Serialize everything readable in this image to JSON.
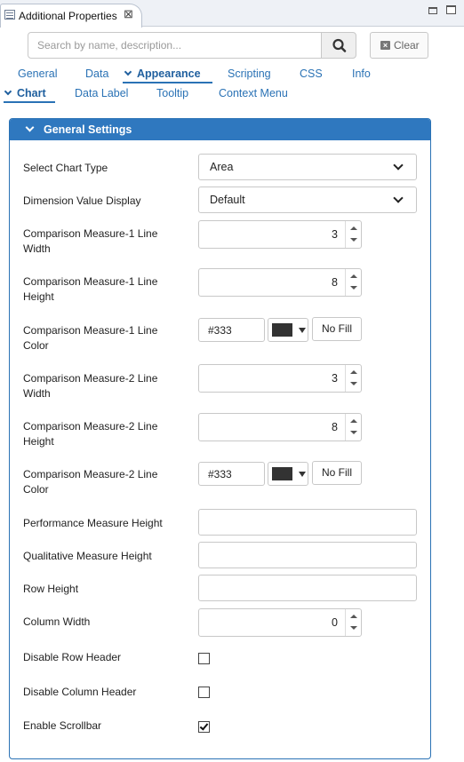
{
  "view": {
    "title": "Additional Properties",
    "close_glyph": "⊠"
  },
  "search": {
    "placeholder": "Search by name, description...",
    "value": "",
    "clear_label": "Clear"
  },
  "tabs": [
    {
      "label": "General"
    },
    {
      "label": "Data"
    },
    {
      "label": "Appearance",
      "active": true
    },
    {
      "label": "Scripting"
    },
    {
      "label": "CSS"
    },
    {
      "label": "Info"
    }
  ],
  "subtabs": [
    {
      "label": "Chart",
      "active": true
    },
    {
      "label": "Data Label"
    },
    {
      "label": "Tooltip"
    },
    {
      "label": "Context Menu"
    }
  ],
  "section": {
    "title": "General Settings"
  },
  "fields": {
    "chart_type": {
      "label": "Select Chart Type",
      "value": "Area"
    },
    "dimension_display": {
      "label": "Dimension Value Display",
      "value": "Default"
    },
    "cm1_line_width": {
      "label": "Comparison Measure-1 Line Width",
      "value": "3"
    },
    "cm1_line_height": {
      "label": "Comparison Measure-1 Line Height",
      "value": "8"
    },
    "cm1_line_color": {
      "label": "Comparison Measure-1 Line Color",
      "value": "#333",
      "swatch": "#333333",
      "nofill_label": "No Fill"
    },
    "cm2_line_width": {
      "label": "Comparison Measure-2 Line Width",
      "value": "3"
    },
    "cm2_line_height": {
      "label": "Comparison Measure-2 Line Height",
      "value": "8"
    },
    "cm2_line_color": {
      "label": "Comparison Measure-2 Line Color",
      "value": "#333",
      "swatch": "#333333",
      "nofill_label": "No Fill"
    },
    "performance_height": {
      "label": "Performance Measure Height",
      "value": ""
    },
    "qualitative_height": {
      "label": "Qualitative Measure Height",
      "value": ""
    },
    "row_height": {
      "label": "Row Height",
      "value": ""
    },
    "column_width": {
      "label": "Column Width",
      "value": "0"
    },
    "disable_row_header": {
      "label": "Disable Row Header",
      "checked": false
    },
    "disable_column_header": {
      "label": "Disable Column Header",
      "checked": false
    },
    "enable_scrollbar": {
      "label": "Enable Scrollbar",
      "checked": true
    }
  },
  "colors": {
    "accent": "#2f78bf",
    "link": "#2a72b5"
  }
}
